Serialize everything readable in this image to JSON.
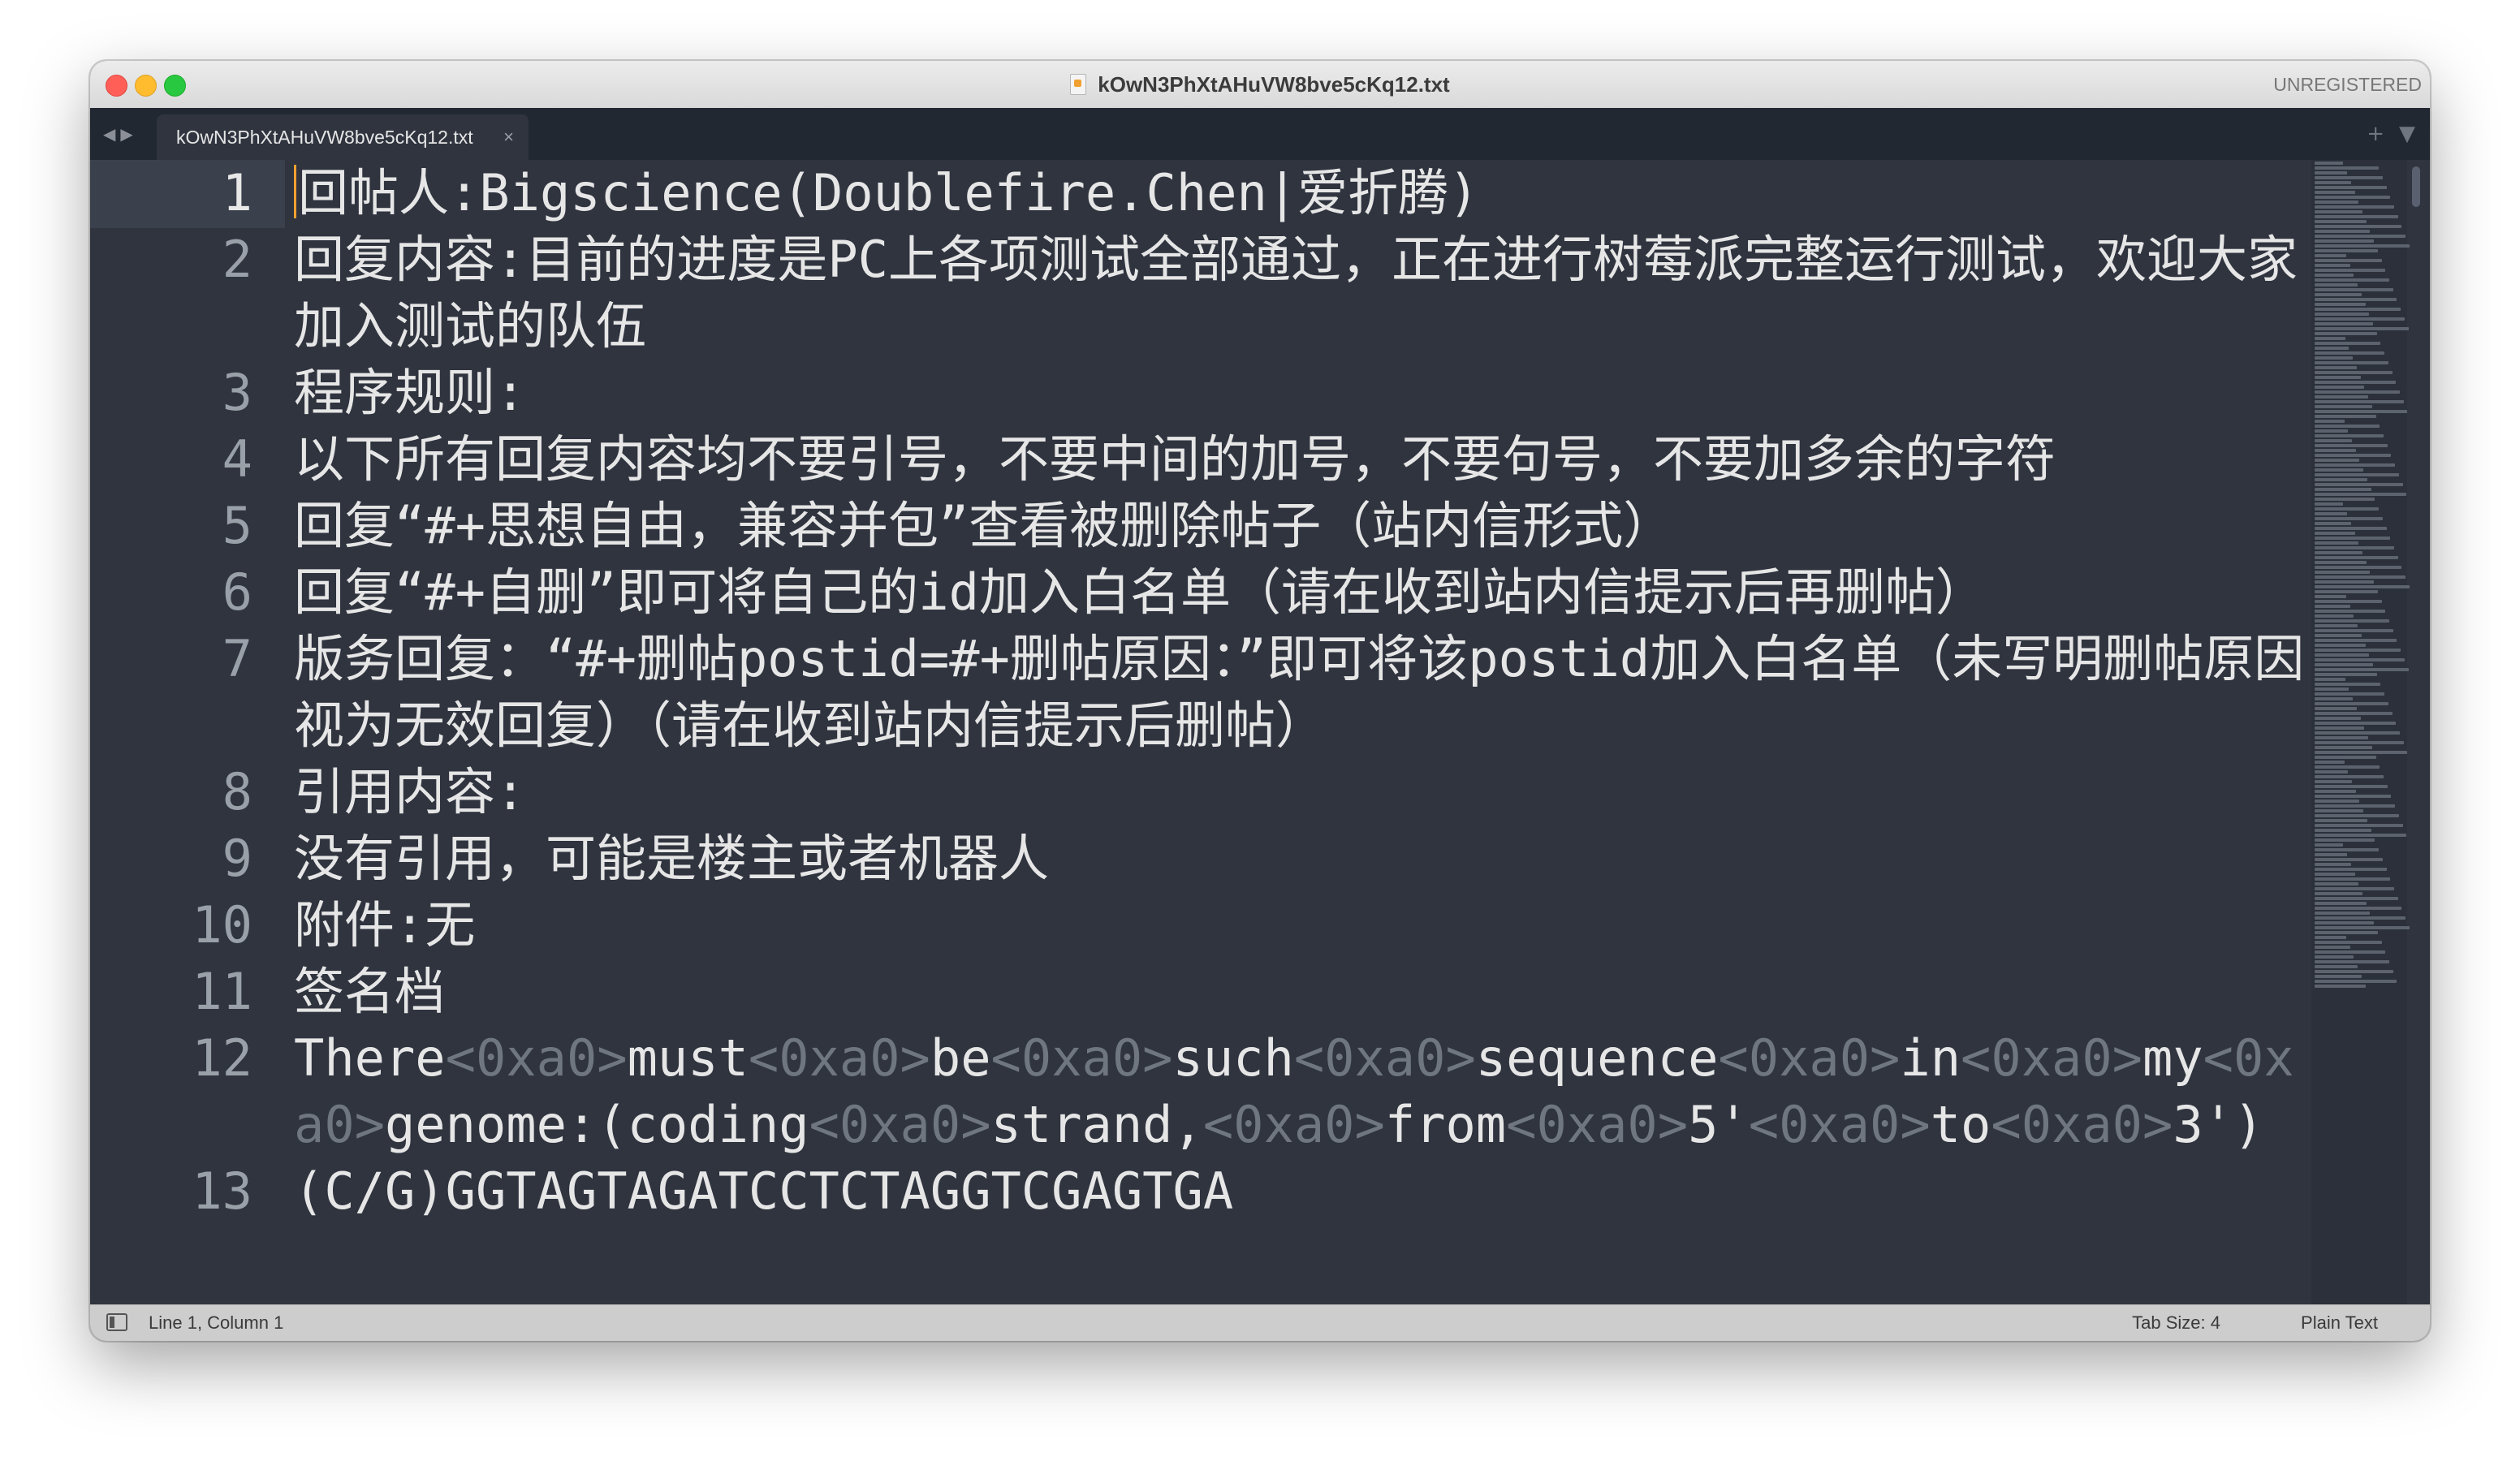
{
  "window": {
    "title": "kOwN3PhXtAHuVW8bve5cKq12.txt",
    "unregistered": "UNREGISTERED"
  },
  "tabbar": {
    "back_icon": "◀",
    "forward_icon": "▶",
    "tab_label": "kOwN3PhXtAHuVW8bve5cKq12.txt",
    "tab_close_icon": "×",
    "new_tab_icon": "+",
    "tab_menu_icon": "▼"
  },
  "editor": {
    "lines": [
      {
        "num": "1",
        "text": "回帖人:Bigscience(Doublefire.Chen|爱折腾)"
      },
      {
        "num": "2",
        "text": "回复内容:目前的进度是PC上各项测试全部通过，正在进行树莓派完整运行测试，欢迎大家加入测试的队伍"
      },
      {
        "num": "3",
        "text": "程序规则:"
      },
      {
        "num": "4",
        "text": "以下所有回复内容均不要引号，不要中间的加号，不要句号，不要加多余的字符"
      },
      {
        "num": "5",
        "text": "回复“#+思想自由，兼容并包”查看被删除帖子（站内信形式）"
      },
      {
        "num": "6",
        "text": "回复“#+自删”即可将自己的id加入白名单（请在收到站内信提示后再删帖）"
      },
      {
        "num": "7",
        "text": "版务回复：“#+删帖postid=#+删帖原因：”即可将该postid加入白名单（未写明删帖原因视为无效回复）（请在收到站内信提示后删帖）"
      },
      {
        "num": "8",
        "text": "引用内容:"
      },
      {
        "num": "9",
        "text": "没有引用，可能是楼主或者机器人"
      },
      {
        "num": "10",
        "text": "附件:无"
      },
      {
        "num": "11",
        "text": "签名档"
      },
      {
        "num": "12",
        "parts": [
          "There",
          "<0xa0>",
          "must",
          "<0xa0>",
          "be",
          "<0xa0>",
          "such",
          "<0xa0>",
          "sequence",
          "<0xa0>",
          "in",
          "<0xa0>",
          "my",
          "<0xa0>",
          "genome:(coding",
          "<0xa0>",
          "strand,",
          "<0xa0>",
          "from",
          "<0xa0>",
          "5'",
          "<0xa0>",
          "to",
          "<0xa0>",
          "3')"
        ]
      },
      {
        "num": "13",
        "text": "(C/G)GGTAGTAGATCCTCTAGGTCGAGTGA"
      }
    ]
  },
  "status": {
    "position": "Line 1, Column 1",
    "tab_size": "Tab Size: 4",
    "syntax": "Plain Text"
  }
}
